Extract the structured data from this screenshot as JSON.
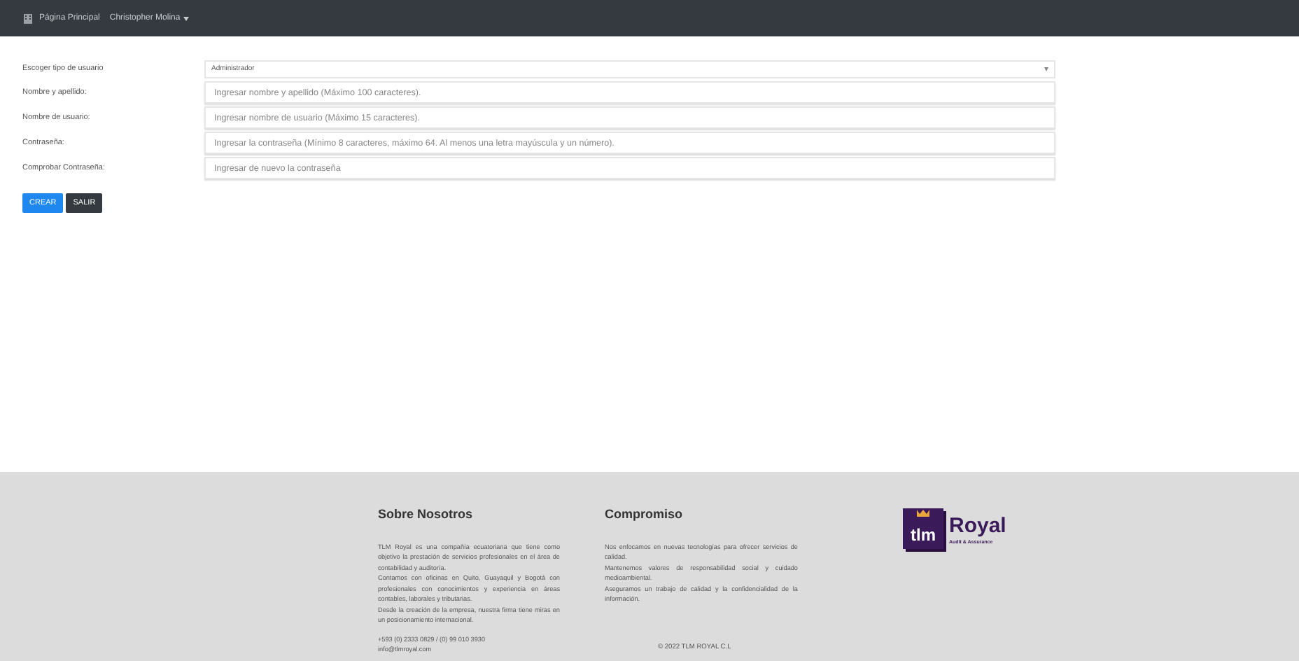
{
  "navbar": {
    "home": "Página Principal",
    "user_menu": "Christopher Molina"
  },
  "form": {
    "fields": [
      {
        "kind": "select",
        "label": "Escoger tipo de usuario",
        "value": "Administrador"
      },
      {
        "kind": "text",
        "label": "Nombre y apellido:",
        "placeholder": "Ingresar nombre y apellido (Máximo 100 caracteres)."
      },
      {
        "kind": "text",
        "label": "Nombre de usuario:",
        "placeholder": "Ingresar nombre de usuario (Máximo 15 caracteres)."
      },
      {
        "kind": "text",
        "label": "Contraseña:",
        "placeholder": "Ingresar la contraseña (Mínimo 8 caracteres, máximo 64. Al menos una letra mayúscula y un número)."
      },
      {
        "kind": "text",
        "label": "Comprobar Contraseña:",
        "placeholder": "Ingresar de nuevo la contraseña"
      }
    ],
    "buttons": [
      {
        "label": "CREAR",
        "kind": "primary"
      },
      {
        "label": "SALIR",
        "kind": "dark"
      }
    ]
  },
  "footer": {
    "about": {
      "title": "Sobre Nosotros",
      "paragraphs": [
        "TLM Royal es una compañía ecuatoriana que tiene como objetivo la prestación de servicios profesionales en el área de contabilidad y auditoría.",
        "Contamos con oficinas en Quito, Guayaquil y Bogotá con profesionales con conocimientos y experiencia en áreas contables, laborales y tributarias.",
        "Desde la creación de la empresa, nuestra firma tiene miras en un posicionamiento internacional."
      ],
      "phone": "+593 (0) 2333 0829 / (0) 99 010 3930",
      "email": "info@tlmroyal.com"
    },
    "commitment": {
      "title": "Compromiso",
      "paragraphs": [
        "Nos enfocamos en nuevas tecnologías para ofrecer servicios de calidad.",
        "Mantenemos valores de responsabilidad social y cuidado medioambiental.",
        "Aseguramos un trabajo de calidad y la confidencialidad de la información."
      ]
    },
    "logo": {
      "mark": "tlm",
      "name": "Royal",
      "tagline": "Audit & Assurance"
    },
    "copyright": "© 2022 TLM ROYAL C.L"
  }
}
